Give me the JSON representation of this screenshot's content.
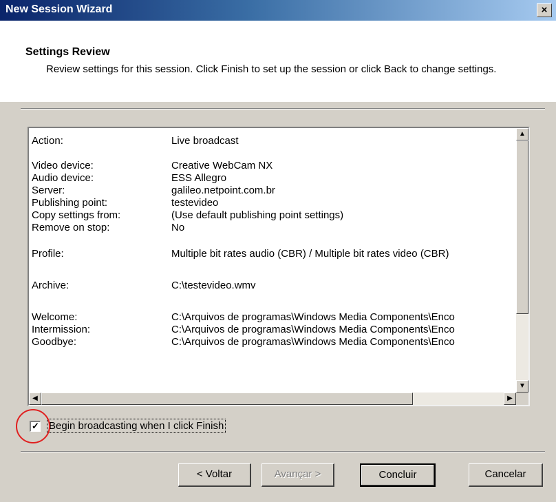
{
  "window": {
    "title": "New Session Wizard",
    "close_label": "×"
  },
  "header": {
    "title": "Settings Review",
    "description": "Review settings for this session. Click Finish to set up the session or click Back to change settings."
  },
  "settings": [
    {
      "label": "Action:",
      "value": "Live broadcast"
    },
    {
      "label": "Video device:",
      "value": "Creative WebCam NX"
    },
    {
      "label": "Audio device:",
      "value": "ESS Allegro"
    },
    {
      "label": "Server:",
      "value": "galileo.netpoint.com.br"
    },
    {
      "label": "Publishing point:",
      "value": "testevideo"
    },
    {
      "label": "Copy settings from:",
      "value": "(Use default publishing point settings)"
    },
    {
      "label": "Remove on stop:",
      "value": "No"
    },
    {
      "label": "Profile:",
      "value": "Multiple bit rates audio (CBR) / Multiple bit rates video (CBR)"
    },
    {
      "label": "Archive:",
      "value": "C:\\testevideo.wmv"
    },
    {
      "label": "Welcome:",
      "value": "C:\\Arquivos de programas\\Windows Media Components\\Enco"
    },
    {
      "label": "Intermission:",
      "value": "C:\\Arquivos de programas\\Windows Media Components\\Enco"
    },
    {
      "label": "Goodbye:",
      "value": "C:\\Arquivos de programas\\Windows Media Components\\Enco"
    }
  ],
  "checkbox": {
    "label": "Begin broadcasting when I click Finish",
    "checked": true,
    "mark": "✓"
  },
  "scroll": {
    "up": "▲",
    "down": "▼",
    "left": "◀",
    "right": "▶"
  },
  "buttons": {
    "back": "< Voltar",
    "next": "Avançar >",
    "finish": "Concluir",
    "cancel": "Cancelar"
  }
}
